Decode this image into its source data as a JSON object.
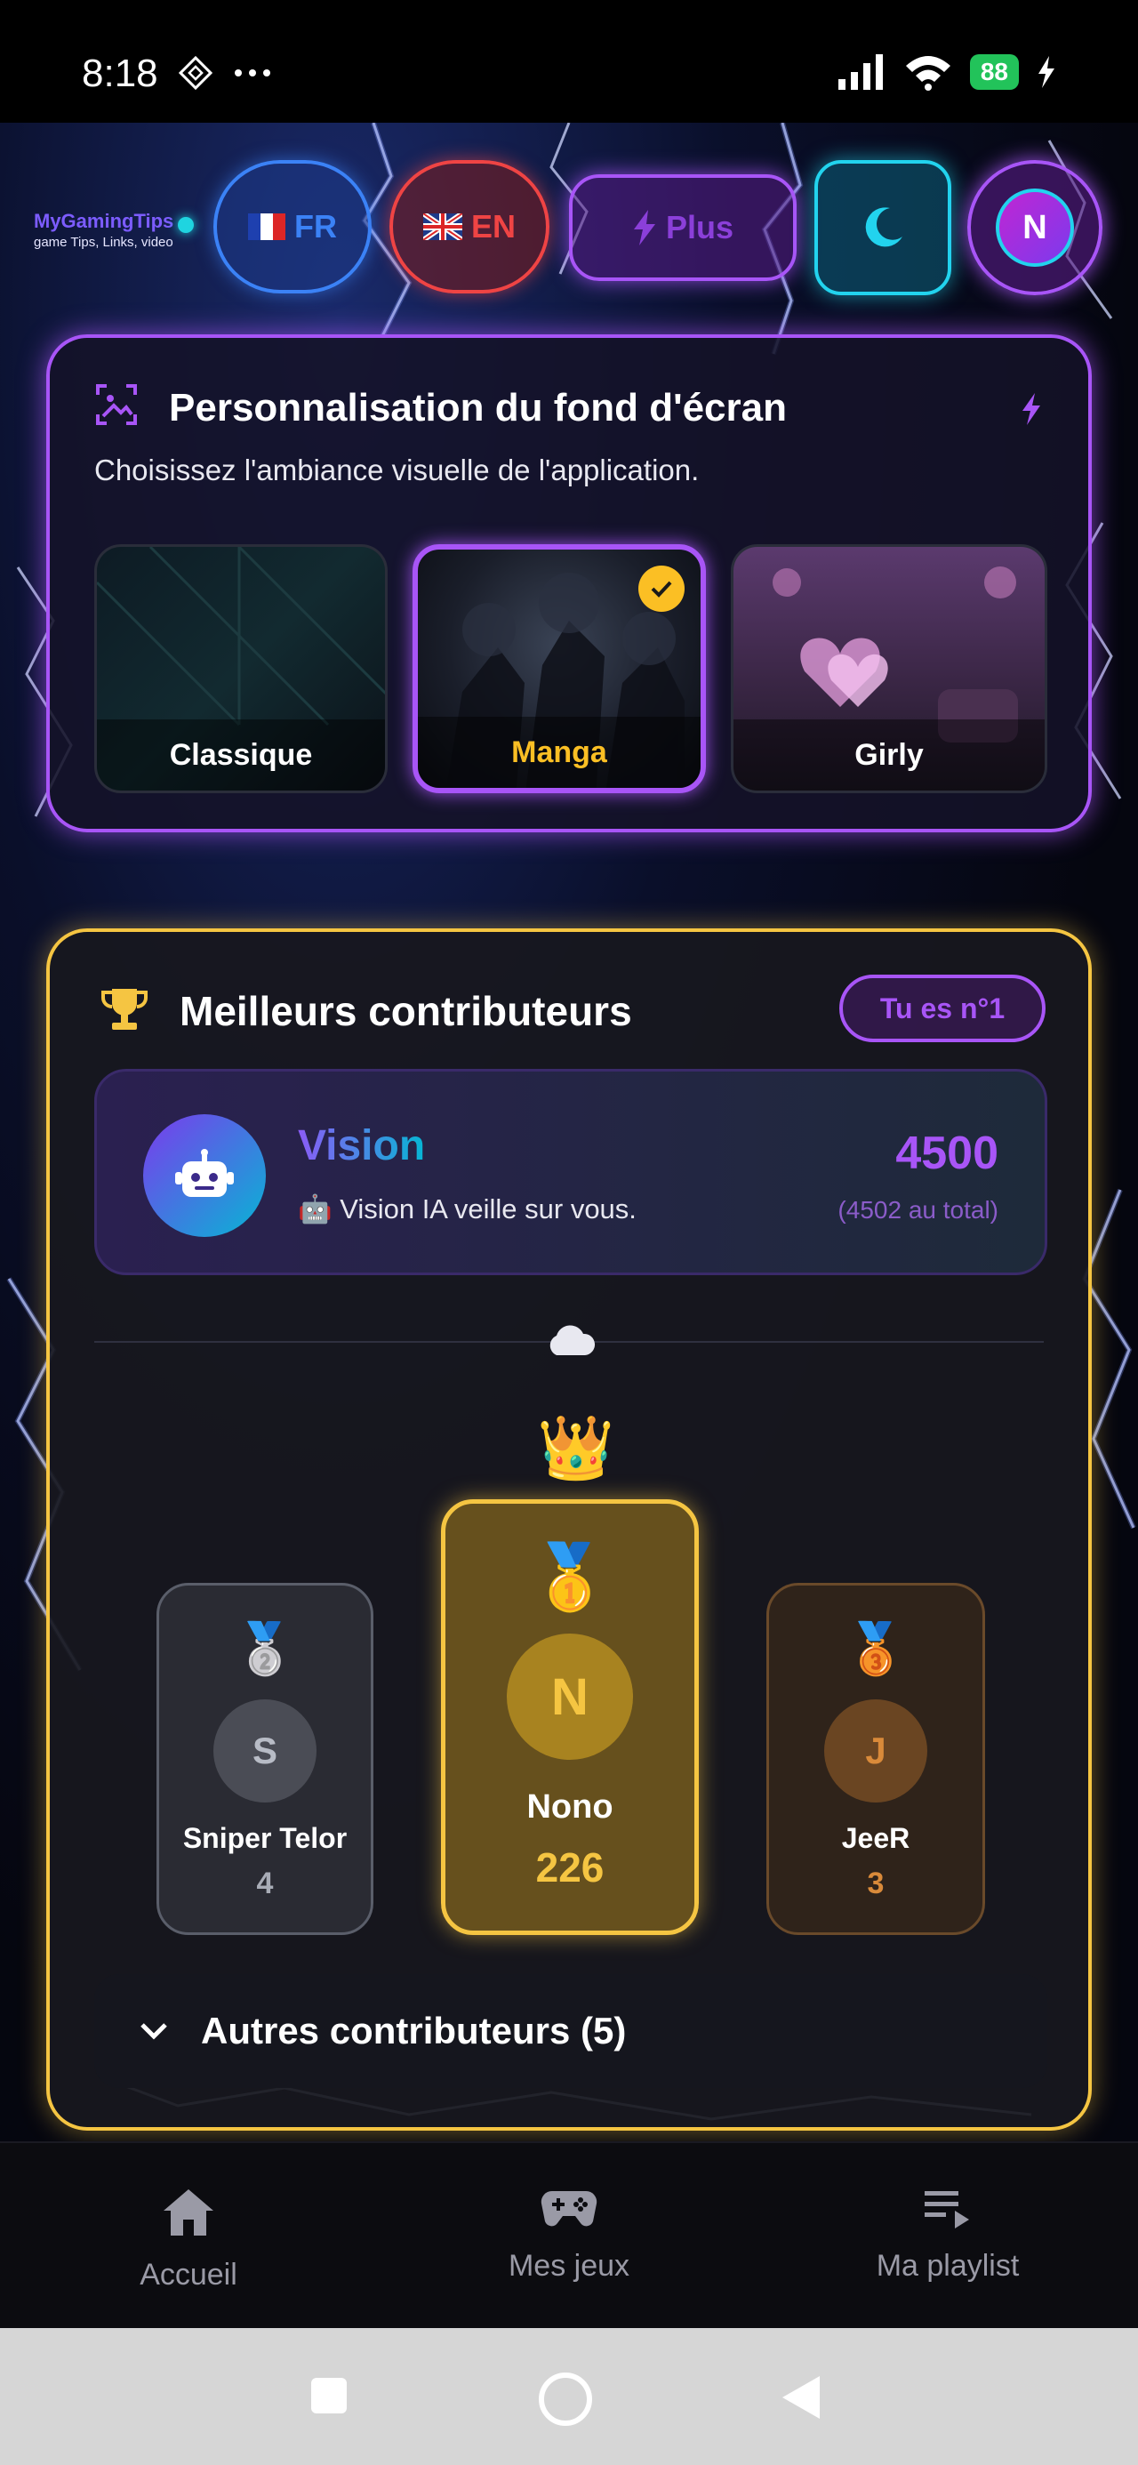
{
  "status": {
    "time": "8:18",
    "battery": "88"
  },
  "topbar": {
    "logo_title": "MyGamingTips",
    "logo_sub": "game Tips, Links, video",
    "lang_fr": "FR",
    "lang_en": "EN",
    "plus_label": "Plus",
    "avatar_initial": "N"
  },
  "wallpaper": {
    "title": "Personnalisation du fond d'écran",
    "subtitle": "Choisissez l'ambiance visuelle de l'application.",
    "themes": [
      {
        "label": "Classique",
        "selected": false
      },
      {
        "label": "Manga",
        "selected": true
      },
      {
        "label": "Girly",
        "selected": false
      }
    ]
  },
  "contributors": {
    "title": "Meilleurs contributeurs",
    "rank_badge": "Tu es n°1",
    "vision": {
      "name": "Vision",
      "message": "🤖 Vision IA veille sur vous.",
      "score": "4500",
      "total": "(4502 au total)"
    },
    "podium": [
      {
        "rank": 2,
        "initial": "S",
        "name": "Sniper Telor",
        "score": "4"
      },
      {
        "rank": 1,
        "initial": "N",
        "name": "Nono",
        "score": "226"
      },
      {
        "rank": 3,
        "initial": "J",
        "name": "JeeR",
        "score": "3"
      }
    ],
    "others_label": "Autres contributeurs (5)"
  },
  "nav": {
    "home": "Accueil",
    "games": "Mes jeux",
    "playlist": "Ma playlist"
  },
  "colors": {
    "accent_purple": "#a855f7",
    "accent_gold": "#f5c542",
    "accent_cyan": "#22d3ee"
  }
}
